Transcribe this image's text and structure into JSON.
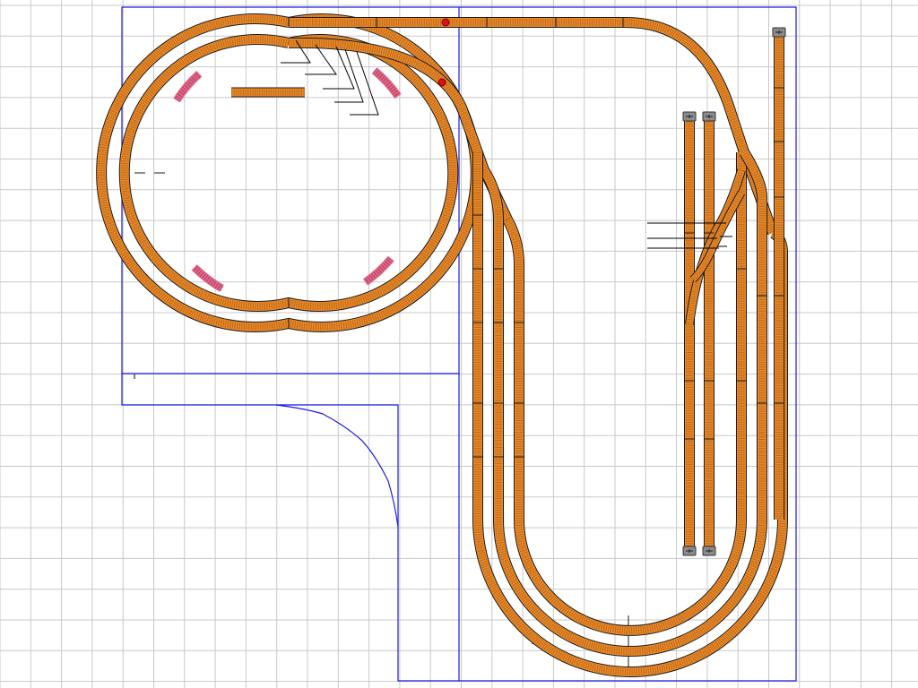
{
  "colors": {
    "grid": "#c8c8c8",
    "background": "#ffffff",
    "boundary": "#1a1ae6",
    "track_fill": "#e8892a",
    "track_edge": "#1a1a1a",
    "ties": "#9a4f0a",
    "crossing_highlight": "#e06a8c",
    "signal_marker": "#e01010",
    "bumper": "#8c8c8c"
  },
  "icons": {
    "signal": "red-dot-signal-icon",
    "bumper": "buffer-stop-icon",
    "leader": "label-leader-line"
  }
}
